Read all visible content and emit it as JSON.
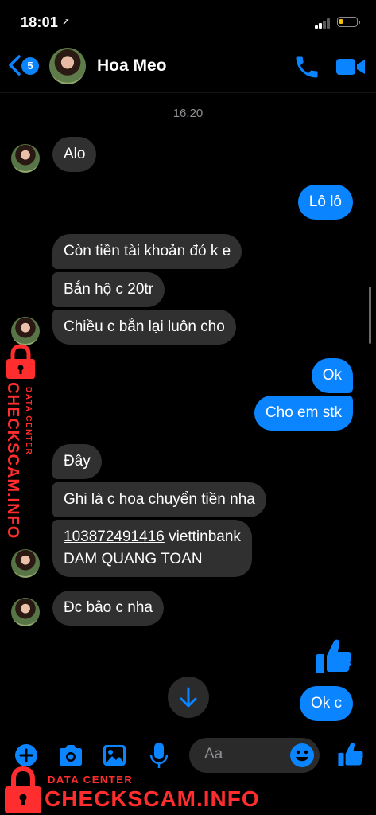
{
  "status_bar": {
    "time": "18:01",
    "location_arrow": "➚"
  },
  "header": {
    "back_badge": "5",
    "contact_name": "Hoa Meo",
    "icons": [
      "chevron-left-icon",
      "phone-icon",
      "video-camera-icon"
    ]
  },
  "conversation": {
    "timestamp": "16:20",
    "messages": [
      {
        "dir": "in",
        "text": "Alo"
      },
      {
        "dir": "out",
        "text": "Lô lô"
      },
      {
        "dir": "in",
        "text": "Còn tiền tài khoản đó k e"
      },
      {
        "dir": "in",
        "text": "Bắn hộ c 20tr"
      },
      {
        "dir": "in",
        "text": "Chiều c bắn lại luôn cho"
      },
      {
        "dir": "out",
        "text": "Ok"
      },
      {
        "dir": "out",
        "text": "Cho em stk"
      },
      {
        "dir": "in",
        "text": "Đây"
      },
      {
        "dir": "in",
        "text": "Ghi là c hoa chuyển tiền nha"
      },
      {
        "dir": "in",
        "account_number": "103872491416",
        "bank": " viettinbank",
        "account_name": "DAM QUANG TOAN"
      },
      {
        "dir": "in",
        "text": "Đc bảo c nha"
      },
      {
        "dir": "out",
        "sticker": "thumbs-up-icon"
      },
      {
        "dir": "out",
        "text": "Ok c"
      }
    ]
  },
  "composer": {
    "placeholder": "Aa",
    "icons": [
      "plus-icon",
      "camera-icon",
      "image-icon",
      "microphone-icon",
      "emoji-icon",
      "thumbs-up-icon"
    ]
  },
  "watermark": {
    "small": "DATA CENTER",
    "main": "CHECKSCAM.INFO"
  },
  "colors": {
    "accent": "#0a84ff",
    "incoming_bubble": "#303030",
    "watermark": "#ff2d2d"
  }
}
